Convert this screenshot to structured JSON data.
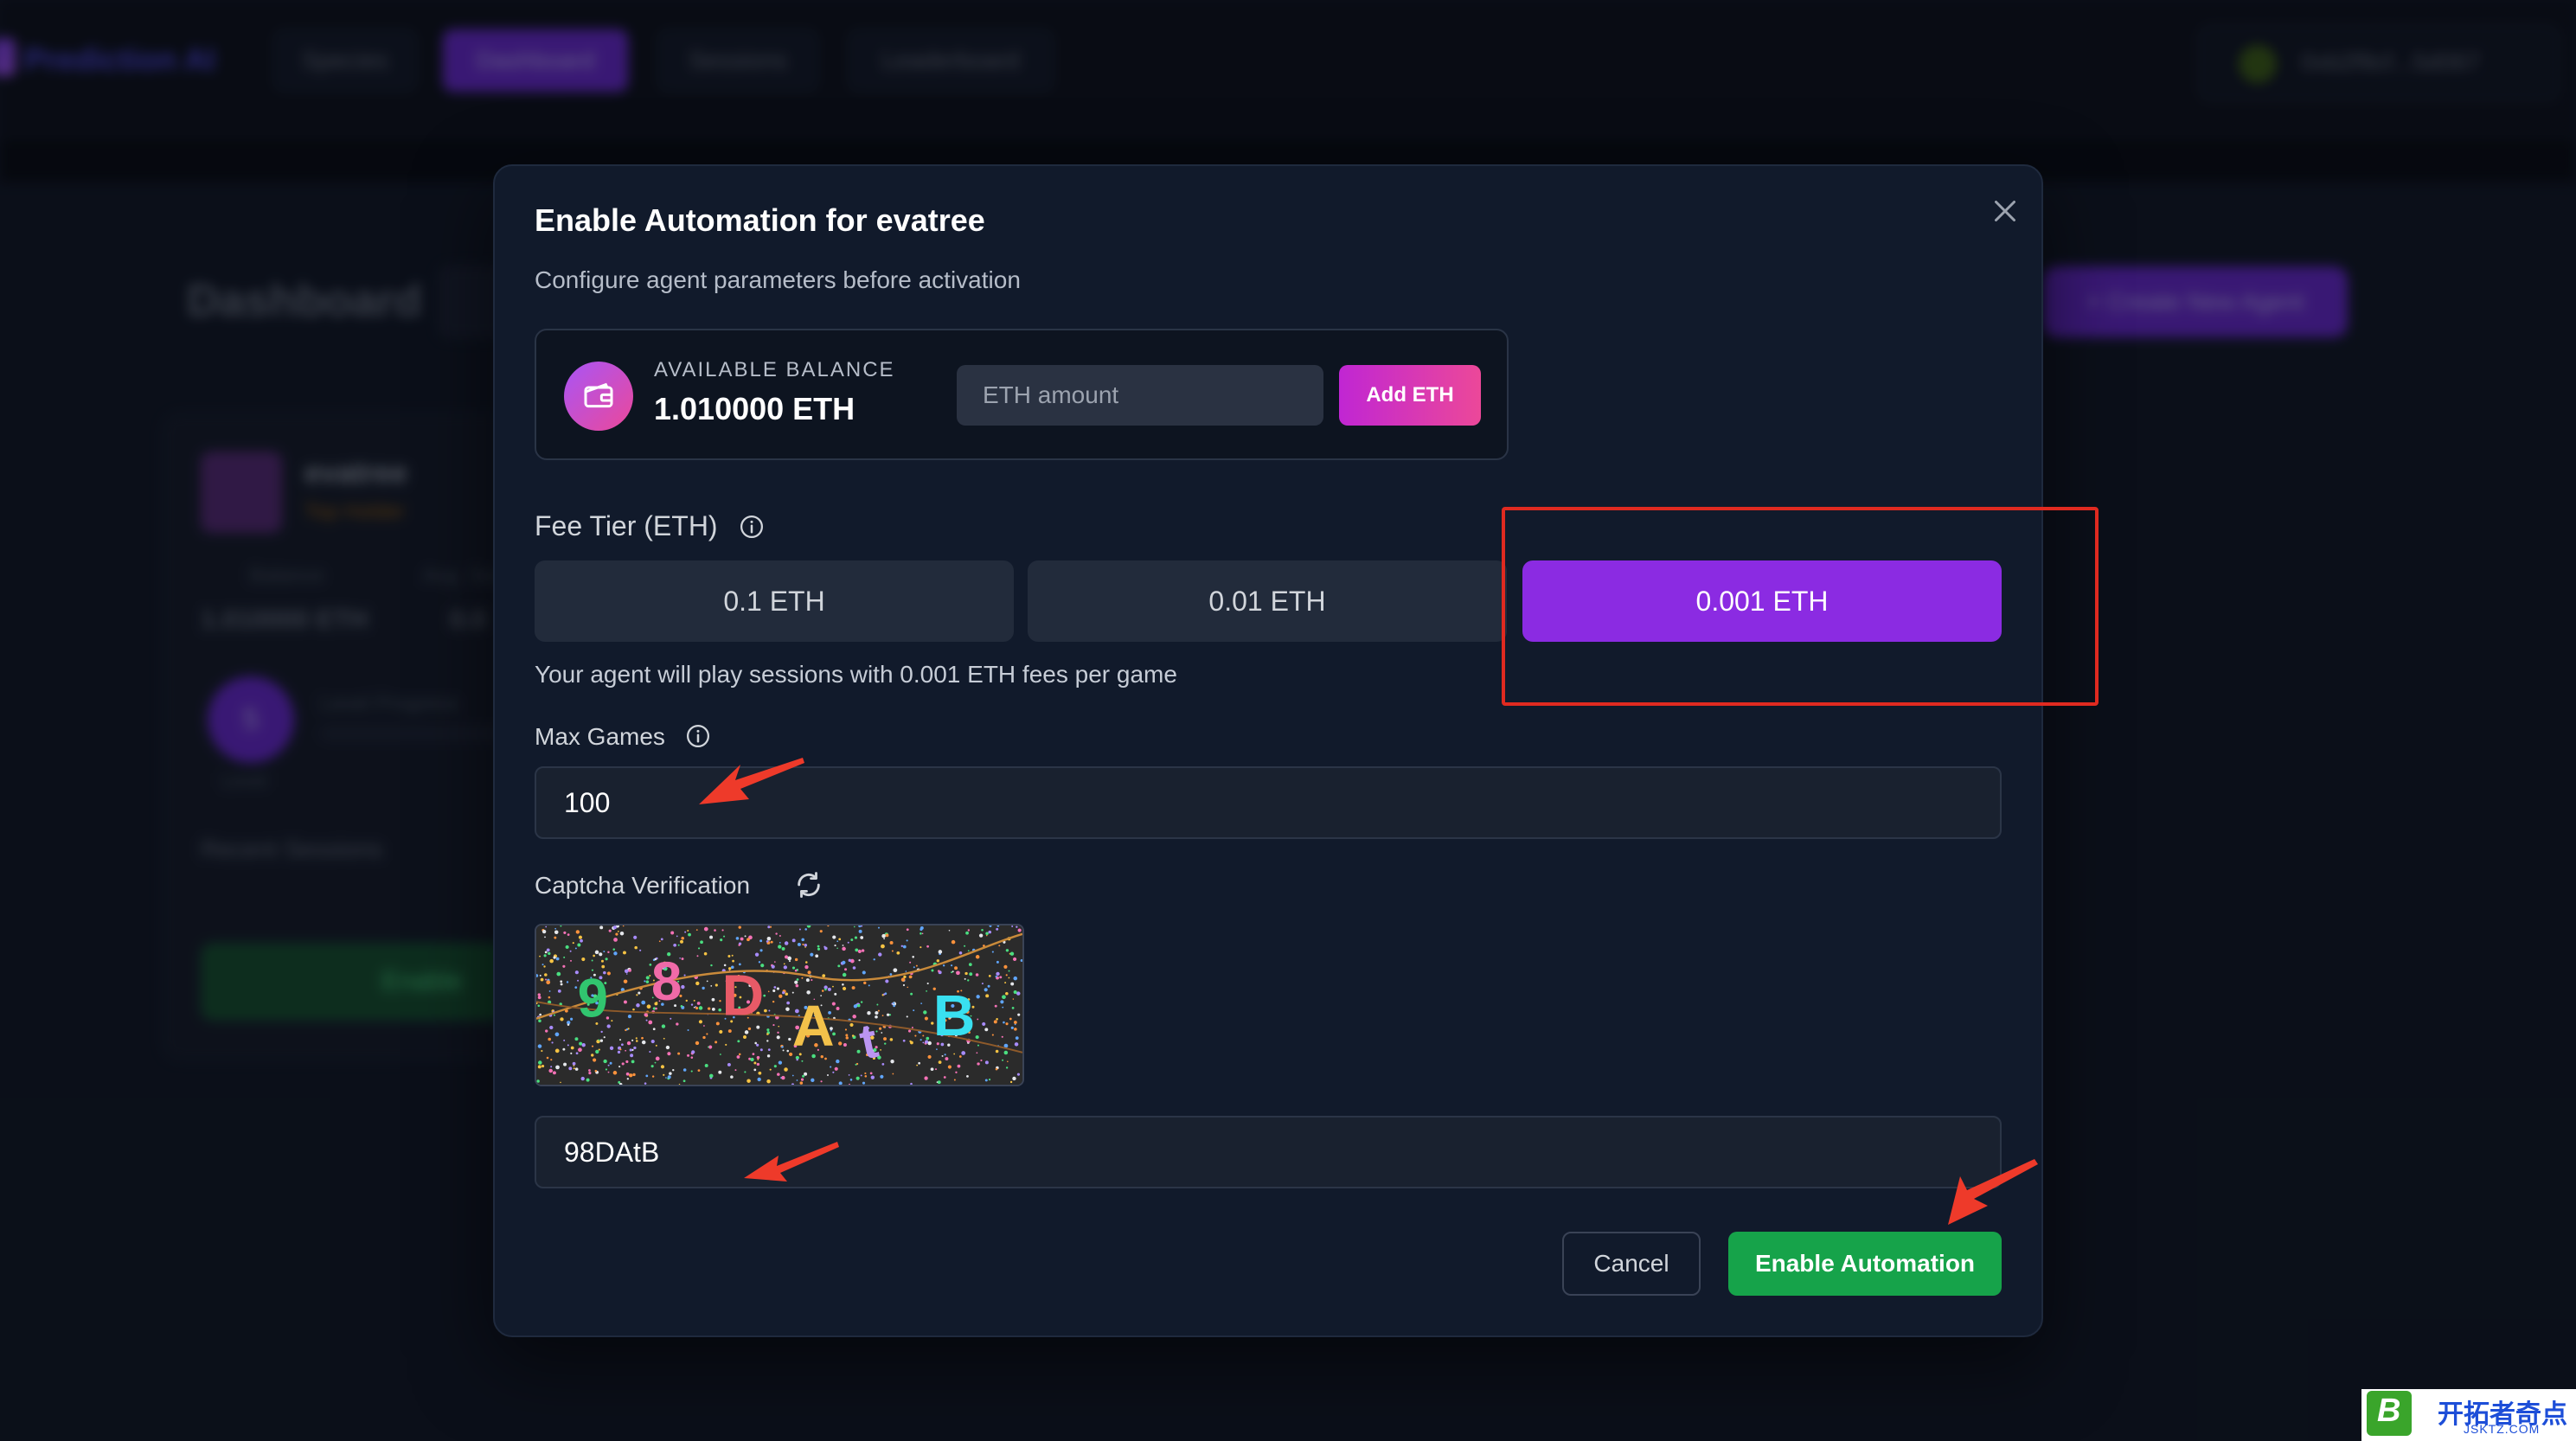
{
  "app": {
    "brand": "Prediction AI",
    "nav": [
      "Species",
      "Dashboard",
      "Sessions",
      "Leaderboard"
    ],
    "wallet": "0xb2f9cf...5d067",
    "dashboard_title": "Dashboard",
    "create_agent": "+ Create New Agent",
    "agent": {
      "name": "evatree",
      "badge": "Top Holder",
      "stats": [
        {
          "label": "Balance",
          "value": "1.010000 ETH"
        },
        {
          "label": "Avg. Score",
          "value": "0.0"
        }
      ],
      "level": "5",
      "level_label": "Level",
      "progress_label": "Level Progress",
      "recent_sessions": "Recent Sessions",
      "enable": "Enable"
    }
  },
  "modal": {
    "title": "Enable Automation for evatree",
    "subtitle": "Configure agent parameters before activation",
    "close_icon": "close-icon",
    "balance": {
      "label": "AVAILABLE BALANCE",
      "value": "1.010000 ETH",
      "input_placeholder": "ETH amount",
      "add_button": "Add ETH",
      "icon": "wallet-icon"
    },
    "fee_tier": {
      "label": "Fee Tier (ETH)",
      "options": [
        "0.1 ETH",
        "0.01 ETH",
        "0.001 ETH"
      ],
      "selected": "0.001 ETH",
      "hint": "Your agent will play sessions with 0.001 ETH fees per game"
    },
    "max_games": {
      "label": "Max Games",
      "value": "100"
    },
    "captcha": {
      "label": "Captcha Verification",
      "chars": [
        "9",
        "8",
        "D",
        "A",
        "t",
        "B"
      ],
      "input_value": "98DAtB",
      "refresh_icon": "refresh-icon"
    },
    "cancel": "Cancel",
    "enable": "Enable Automation"
  },
  "colors": {
    "accent_purple": "#8b2be2",
    "enable_green": "#16a34a",
    "annotation_red": "#e02a20",
    "modal_bg": "#111a2b"
  },
  "watermark": {
    "title": "开拓者奇点",
    "sub": "JSKTZ.COM",
    "logo_letter": "B"
  }
}
